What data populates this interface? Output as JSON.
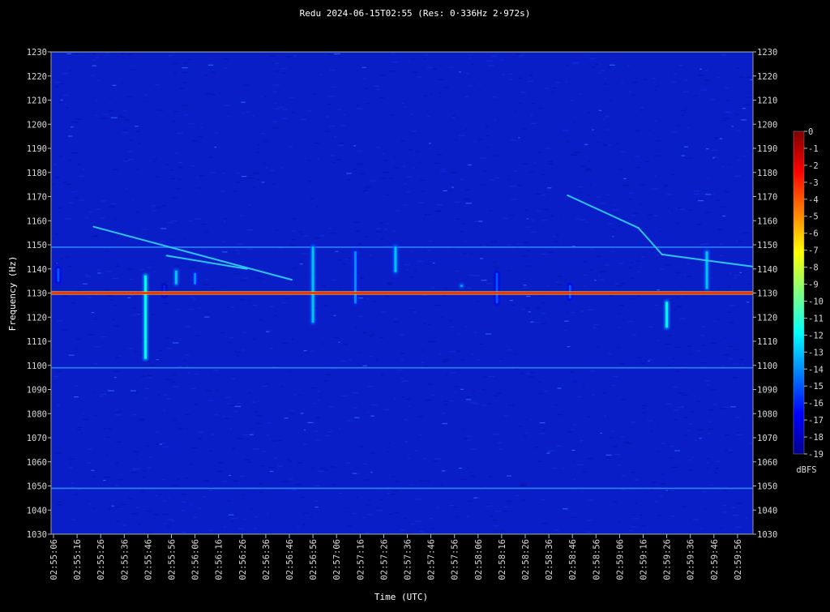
{
  "chart_data": {
    "type": "heatmap",
    "title": "Redu 2024-06-15T02:55 (Res: 0·336Hz 2·972s)",
    "xlabel": "Time (UTC)",
    "ylabel": "Frequency (Hz)",
    "ylim": [
      1030,
      1230
    ],
    "y_ticks": [
      1030,
      1040,
      1050,
      1060,
      1070,
      1080,
      1090,
      1100,
      1110,
      1120,
      1130,
      1140,
      1150,
      1160,
      1170,
      1180,
      1190,
      1200,
      1210,
      1220,
      1230
    ],
    "x_ticks": [
      "02:55:06",
      "02:55:16",
      "02:55:26",
      "02:55:36",
      "02:55:46",
      "02:55:56",
      "02:56:06",
      "02:56:16",
      "02:56:26",
      "02:56:36",
      "02:56:46",
      "02:56:56",
      "02:57:06",
      "02:57:16",
      "02:57:26",
      "02:57:36",
      "02:57:46",
      "02:57:56",
      "02:58:06",
      "02:58:16",
      "02:58:26",
      "02:58:36",
      "02:58:46",
      "02:58:56",
      "02:59:06",
      "02:59:16",
      "02:59:26",
      "02:59:36",
      "02:59:46",
      "02:59:56"
    ],
    "colorbar": {
      "label": "dBFS",
      "ticks": [
        "0",
        "-1",
        "-2",
        "-3",
        "-4",
        "-5",
        "-6",
        "-7",
        "-8",
        "-9",
        "-10",
        "-11",
        "-12",
        "-13",
        "-14",
        "-15",
        "-16",
        "-17",
        "-18",
        "-19"
      ],
      "range": [
        -19,
        0
      ],
      "colormap": "jet"
    },
    "background_color": "#0a1ec8",
    "features": {
      "carrier_hz": 1130,
      "carrier_color": "#ff2a00",
      "horizontal_lines_hz": [
        1030,
        1049,
        1099,
        1149,
        1230
      ],
      "doppler_traces": [
        {
          "t_start": "02:55:23",
          "f_start": 1157.5,
          "t_end": "02:56:47",
          "f_end": 1135.5
        },
        {
          "t_start": "02:55:54",
          "f_start": 1145.5,
          "t_end": "02:56:28",
          "f_end": 1140
        },
        {
          "t_start": "02:58:44",
          "f_start": 1170.5,
          "t_end": "02:59:14",
          "f_end": 1157
        },
        {
          "t_start": "02:59:14",
          "f_start": 1157,
          "t_end": "02:59:24",
          "f_end": 1146
        },
        {
          "t_start": "02:59:24",
          "f_start": 1146,
          "t_end": "03:00:06",
          "f_end": 1140.5
        }
      ],
      "meteor_echoes": [
        {
          "t": "02:55:08",
          "f_lo": 1134,
          "f_hi": 1141,
          "intensity": -15
        },
        {
          "t": "02:55:45",
          "f_lo": 1102,
          "f_hi": 1138,
          "intensity": -12
        },
        {
          "t": "02:55:53",
          "f_lo": 1128,
          "f_hi": 1134,
          "intensity": -16
        },
        {
          "t": "02:55:58",
          "f_lo": 1133,
          "f_hi": 1140,
          "intensity": -13
        },
        {
          "t": "02:56:06",
          "f_lo": 1133,
          "f_hi": 1139,
          "intensity": -14
        },
        {
          "t": "02:56:56",
          "f_lo": 1117,
          "f_hi": 1150,
          "intensity": -13
        },
        {
          "t": "02:57:14",
          "f_lo": 1125,
          "f_hi": 1148,
          "intensity": -14
        },
        {
          "t": "02:57:31",
          "f_lo": 1138,
          "f_hi": 1150,
          "intensity": -13
        },
        {
          "t": "02:57:59",
          "f_lo": 1132,
          "f_hi": 1134,
          "intensity": -13
        },
        {
          "t": "02:58:14",
          "f_lo": 1125,
          "f_hi": 1139,
          "intensity": -15
        },
        {
          "t": "02:58:45",
          "f_lo": 1127,
          "f_hi": 1134,
          "intensity": -15
        },
        {
          "t": "02:59:26",
          "f_lo": 1115,
          "f_hi": 1127,
          "intensity": -12
        },
        {
          "t": "02:59:43",
          "f_lo": 1131,
          "f_hi": 1148,
          "intensity": -13
        }
      ]
    }
  }
}
